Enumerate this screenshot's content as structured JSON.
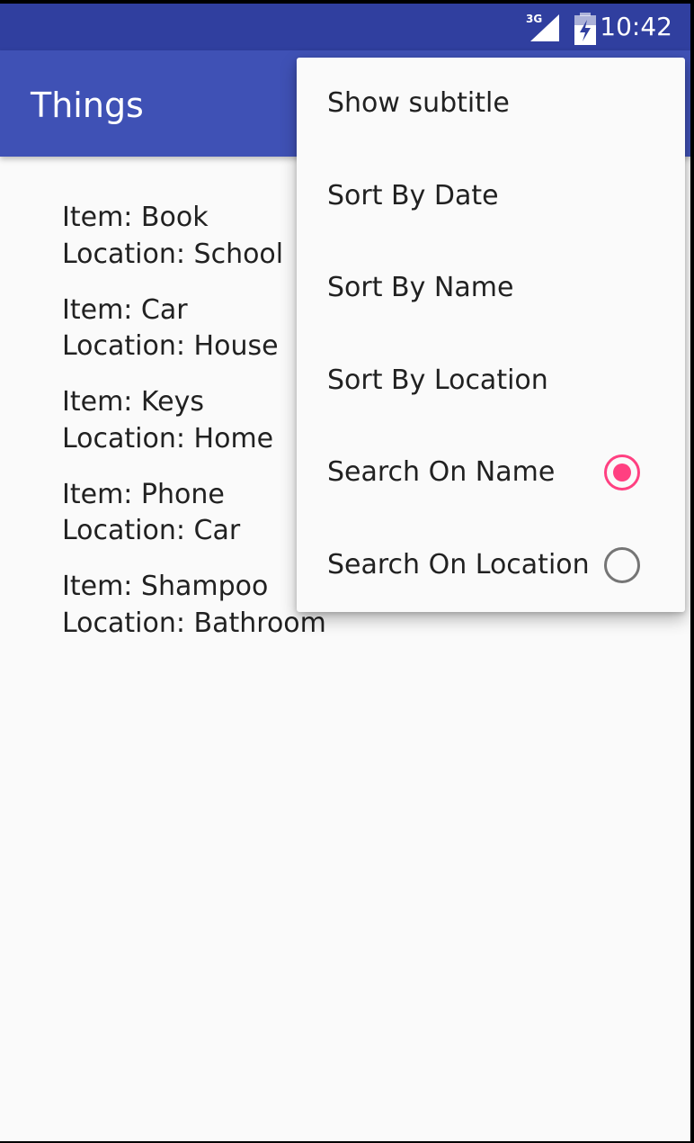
{
  "status_bar": {
    "network_label": "3G",
    "time": "10:42",
    "icons": [
      "signal-3g-icon",
      "battery-charging-icon"
    ]
  },
  "app_bar": {
    "title": "Things"
  },
  "things": [
    {
      "item": "Item: Book",
      "location": "Location: School"
    },
    {
      "item": "Item: Car",
      "location": "Location: House"
    },
    {
      "item": "Item: Keys",
      "location": "Location: Home"
    },
    {
      "item": "Item: Phone",
      "location": "Location: Car"
    },
    {
      "item": "Item: Shampoo",
      "location": "Location: Bathroom"
    }
  ],
  "overflow_menu": {
    "items": [
      {
        "label": "Show subtitle"
      },
      {
        "label": "Sort By Date"
      },
      {
        "label": "Sort By Name"
      },
      {
        "label": "Sort By Location"
      },
      {
        "label": "Search On Name",
        "radio": true,
        "checked": true
      },
      {
        "label": "Search On Location",
        "radio": true,
        "checked": false
      }
    ]
  },
  "colors": {
    "status_bar": "#303f9f",
    "app_bar": "#3f51b5",
    "accent": "#ff4081",
    "background": "#fafafa",
    "text_primary": "#212121",
    "radio_unchecked": "#757575"
  }
}
